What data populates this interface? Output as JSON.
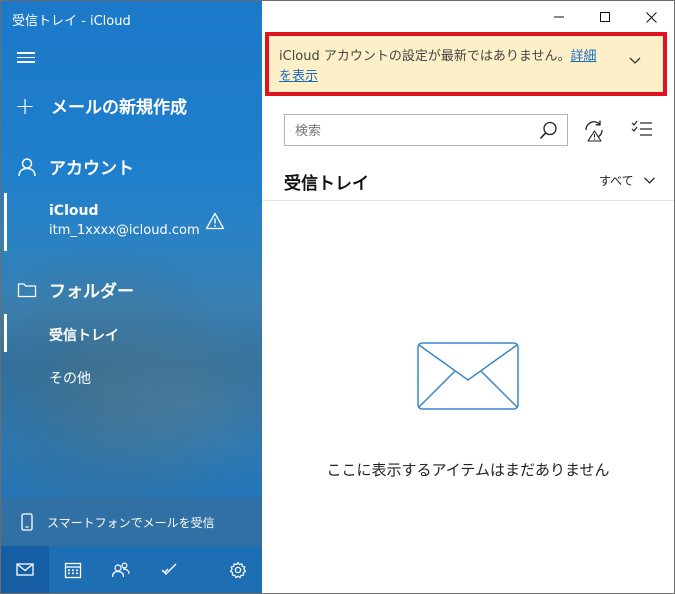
{
  "window": {
    "title": "受信トレイ - iCloud"
  },
  "sidebar": {
    "menu_icon": "hamburger-icon",
    "new_mail_label": "メールの新規作成",
    "account_header": "アカウント",
    "account": {
      "name": "iCloud",
      "email": "itm_1xxxx@icloud.com",
      "status_icon": "warning-icon"
    },
    "folders_header": "フォルダー",
    "folders": [
      {
        "label": "受信トレイ",
        "selected": true
      },
      {
        "label": "その他",
        "selected": false
      }
    ],
    "phone_banner": "スマートフォンでメールを受信",
    "bottom_nav": [
      "mail-icon",
      "calendar-icon",
      "people-icon",
      "todo-icon",
      "settings-icon"
    ]
  },
  "banner": {
    "message": "iCloud アカウントの設定が最新ではありません。",
    "link": "詳細を表示",
    "highlight_color": "#e0141e"
  },
  "search": {
    "placeholder": "検索"
  },
  "inbox": {
    "title": "受信トレイ",
    "filter": "すべて",
    "empty_message": "ここに表示するアイテムはまだありません"
  },
  "colors": {
    "accent": "#1c79c9",
    "banner_bg": "#fdf0c8",
    "link": "#1a6bc4"
  }
}
